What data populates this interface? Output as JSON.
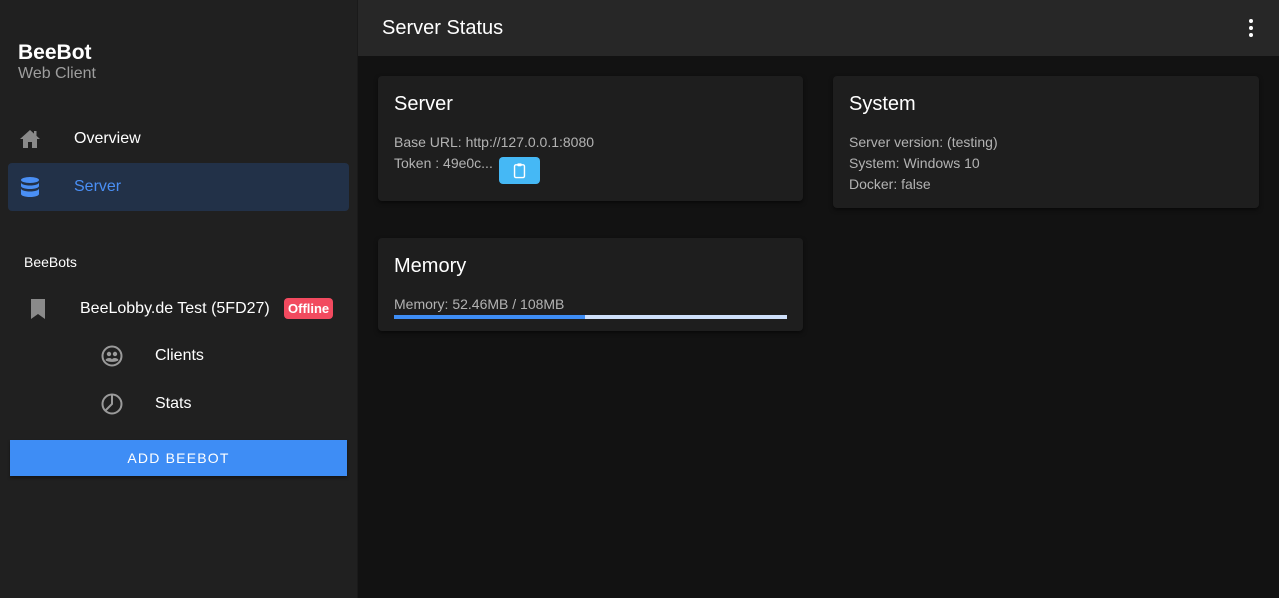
{
  "app": {
    "title": "BeeBot",
    "subtitle": "Web Client"
  },
  "nav": {
    "overview": {
      "label": "Overview",
      "icon": "home-icon"
    },
    "server": {
      "label": "Server",
      "icon": "database-icon",
      "active": true
    }
  },
  "bots": {
    "heading": "BeeBots",
    "items": [
      {
        "label": "BeeLobby.de Test (5FD27)",
        "status": "Offline",
        "icon": "bookmark-icon",
        "subitems": [
          {
            "label": "Clients",
            "icon": "clients-icon"
          },
          {
            "label": "Stats",
            "icon": "pie-chart-icon"
          }
        ]
      }
    ],
    "add_label": "ADD BEEBOT"
  },
  "topbar": {
    "title": "Server Status",
    "menu_icon": "more-vertical-icon"
  },
  "server_card": {
    "title": "Server",
    "base_url": "Base URL: http://127.0.0.1:8080",
    "token": "Token : 49e0c...",
    "copy_icon": "clipboard-icon"
  },
  "system_card": {
    "title": "System",
    "version": "Server version: (testing)",
    "system": "System: Windows 10",
    "docker": "Docker: false"
  },
  "memory_card": {
    "title": "Memory",
    "text": "Memory: 52.46MB / 108MB",
    "used_fraction": 0.486
  },
  "colors": {
    "accent": "#3e8df5",
    "badge": "#f24a5f",
    "copy": "#45b8f5"
  }
}
